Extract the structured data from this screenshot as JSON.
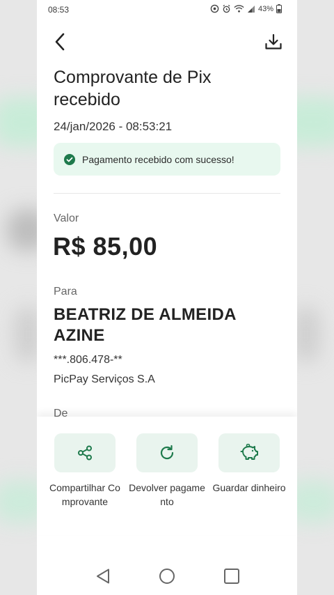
{
  "status_bar": {
    "time": "08:53",
    "battery": "43%"
  },
  "header": {
    "title": "Comprovante de Pix recebido",
    "datetime": "24/jan/2026 - 08:53:21"
  },
  "banner": {
    "text": "Pagamento recebido com sucesso!",
    "color": "#e8f8ef",
    "icon": "check-circle-icon"
  },
  "details": {
    "value_label": "Valor",
    "amount": "R$ 85,00",
    "to_label": "Para",
    "recipient_name": "BEATRIZ DE ALMEIDA AZINE",
    "recipient_document": "***.806.478-**",
    "recipient_institution": "PicPay Serviços S.A",
    "from_label": "De"
  },
  "actions": [
    {
      "label": "Compartilhar Comprovante",
      "icon": "share-icon"
    },
    {
      "label": "Devolver pagamento",
      "icon": "refresh-icon"
    },
    {
      "label": "Guardar dinheiro",
      "icon": "piggy-bank-icon"
    }
  ],
  "colors": {
    "accent": "#1e7a4c",
    "action_bg": "#e9f4ee"
  }
}
